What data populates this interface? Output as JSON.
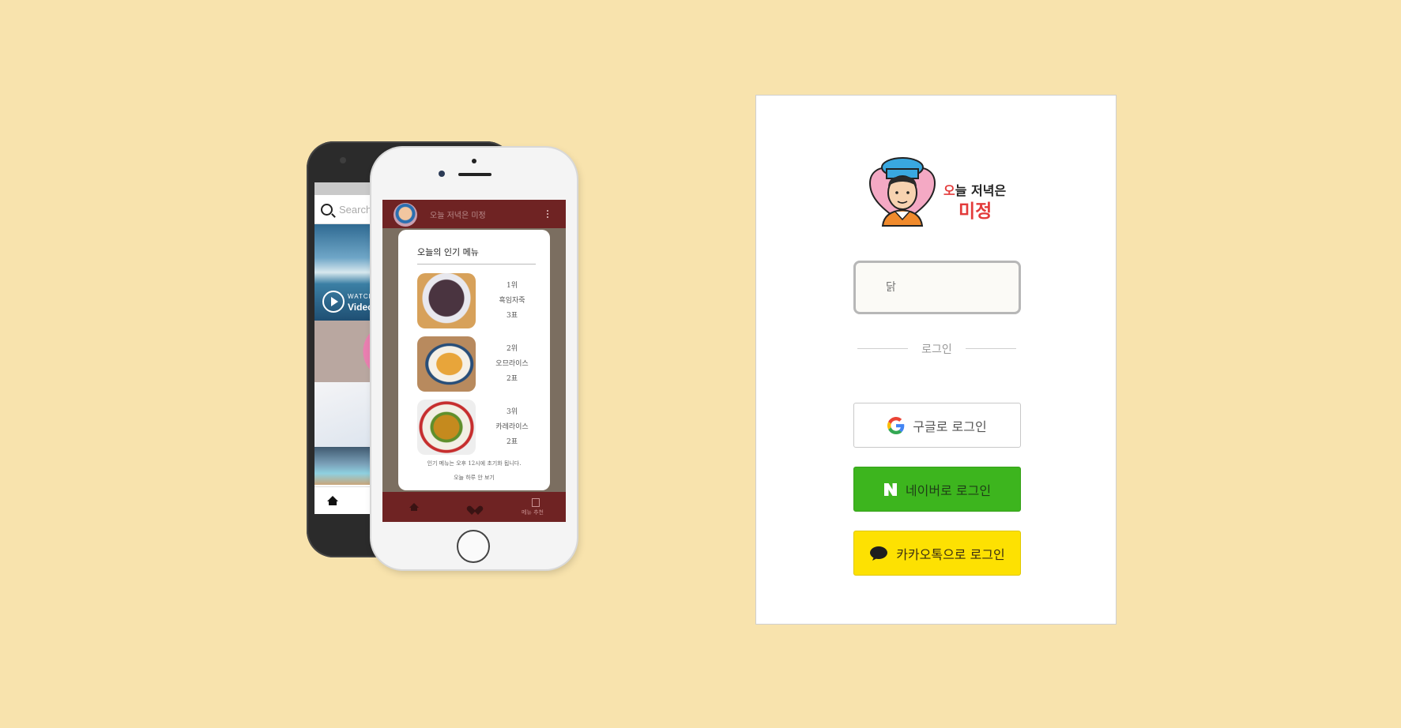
{
  "back_phone": {
    "search_placeholder": "Search",
    "watch_label": "WATCH",
    "video_label": "Video"
  },
  "front_phone": {
    "app_title": "오늘 저녁은 미정",
    "popup_title": "오늘의 인기 메뉴",
    "ranks": [
      {
        "rank": "1위",
        "name": "흑임자죽",
        "votes": "3표"
      },
      {
        "rank": "2위",
        "name": "오므라이스",
        "votes": "2표"
      },
      {
        "rank": "3위",
        "name": "카레라이스",
        "votes": "2표"
      }
    ],
    "note": "인기 메뉴는 오후 12시에 초기화 됩니다.",
    "hide_today": "오늘 하루 안 보기",
    "nav_menu_label": "메뉴 추천"
  },
  "login": {
    "logo_line1_accent": "오",
    "logo_line1_rest": "늘 저녁은",
    "logo_line2": "미정",
    "input_placeholder": "닭",
    "divider_text": "로그인",
    "google_label": "구글로 로그인",
    "naver_label": "네이버로 로그인",
    "kakao_label": "카카오톡으로 로그인"
  },
  "colors": {
    "background": "#f8e3ad",
    "app_bar": "#6f2323",
    "accent_red": "#e33b3b",
    "naver_green": "#3db51e",
    "kakao_yellow": "#fde102"
  },
  "icons": [
    "search-icon",
    "play-icon",
    "home-icon",
    "heart-icon",
    "menu-icon",
    "kebab-icon",
    "google-icon",
    "naver-icon",
    "kakao-icon"
  ]
}
